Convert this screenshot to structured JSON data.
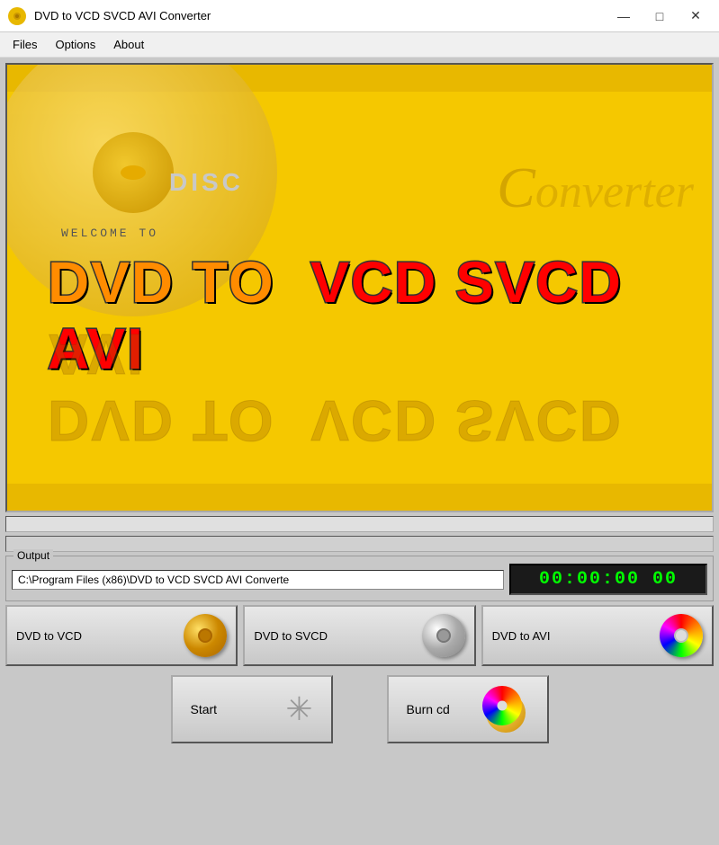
{
  "window": {
    "title": "DVD to VCD SVCD AVI Converter",
    "controls": {
      "minimize": "—",
      "maximize": "□",
      "close": "✕"
    }
  },
  "menubar": {
    "items": [
      {
        "label": "Files",
        "id": "files"
      },
      {
        "label": "Options",
        "id": "options"
      },
      {
        "label": "About",
        "id": "about"
      }
    ]
  },
  "banner": {
    "disc_label": "DISC",
    "welcome_text": "WELCOME TO",
    "title_dvd_to": "DVD TO",
    "title_vcd_svcd_avi": "VCD SVCD AVI",
    "converter_text": "Converter"
  },
  "output": {
    "label": "Output",
    "path": "C:\\Program Files (x86)\\DVD to VCD SVCD AVI Converte",
    "timer": "00:00:00  00"
  },
  "convert_buttons": [
    {
      "label": "DVD to VCD",
      "disc_type": "gold",
      "id": "dvd-to-vcd"
    },
    {
      "label": "DVD to SVCD",
      "disc_type": "silver",
      "id": "dvd-to-svcd"
    },
    {
      "label": "DVD to AVI",
      "disc_type": "rainbow",
      "id": "dvd-to-avi"
    }
  ],
  "action_buttons": [
    {
      "label": "Start",
      "icon": "star",
      "id": "start"
    },
    {
      "label": "Burn cd",
      "icon": "burn",
      "id": "burn-cd"
    }
  ]
}
